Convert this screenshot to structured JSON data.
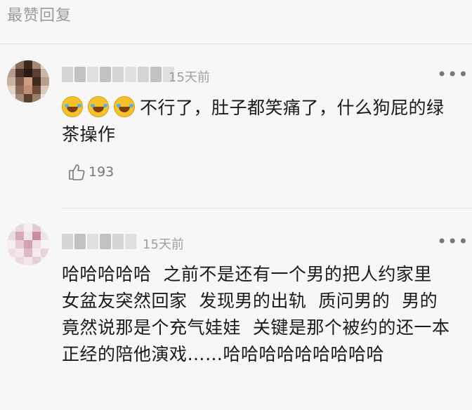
{
  "section": {
    "title": "最赞回复"
  },
  "comments": [
    {
      "time": "15天前",
      "more": "•••",
      "text": "不行了，肚子都笑痛了，什么狗屁的绿茶操作",
      "emoji_icon": "rolling-laughing-emoji",
      "emoji_count": 3,
      "likes": "193"
    },
    {
      "time": "15天前",
      "more": "•••",
      "text": "哈哈哈哈哈  之前不是还有一个男的把人约家里  女盆友突然回家  发现男的出轨  质问男的  男的竟然说那是个充气娃娃  关键是那个被约的还一本正经的陪他演戏……哈哈哈哈哈哈哈哈哈"
    }
  ]
}
